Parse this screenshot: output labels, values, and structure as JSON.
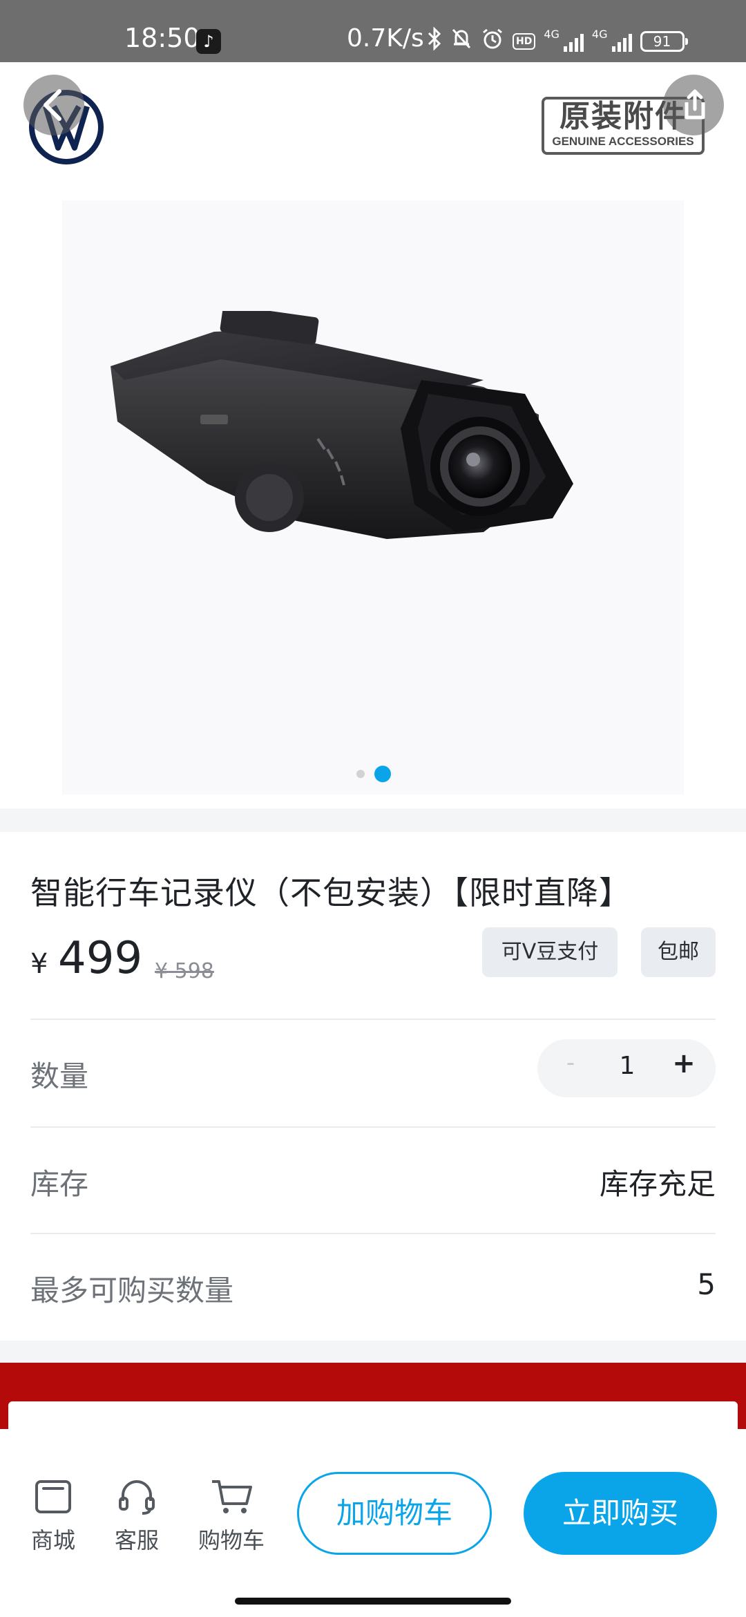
{
  "status_bar": {
    "time": "18:50",
    "net_speed": "0.7K/s",
    "hd": "HD",
    "net_1": "4G",
    "net_2": "4G",
    "battery": "91"
  },
  "hero": {
    "brand_badge_cn": "原装附件",
    "brand_badge_en": "GENUINE ACCESSORIES",
    "slide_count": 2,
    "active_slide": 2
  },
  "product": {
    "title": "智能行车记录仪（不包安装）【限时直降】",
    "currency": "¥",
    "price": "499",
    "original_price": "¥ 598",
    "tags": [
      "可V豆支付",
      "包邮"
    ]
  },
  "rows": {
    "quantity_label": "数量",
    "quantity_minus": "-",
    "quantity_value": "1",
    "quantity_plus": "+",
    "stock_label": "库存",
    "stock_value": "库存充足",
    "max_label": "最多可购买数量",
    "max_value": "5"
  },
  "bottom_nav": {
    "shop": "商城",
    "service": "客服",
    "cart": "购物车",
    "add_to_cart": "加购物车",
    "buy_now": "立即购买"
  },
  "colors": {
    "accent": "#0aa5e8",
    "banner_red": "#b40a0a",
    "status_bar": "#6e6e6e"
  },
  "icons": [
    "tiktok-icon",
    "bluetooth-icon",
    "mute-bell-icon",
    "alarm-icon",
    "signal-icon",
    "battery-icon",
    "back-icon",
    "share-icon",
    "shop-bag-icon",
    "headset-icon",
    "cart-icon"
  ]
}
